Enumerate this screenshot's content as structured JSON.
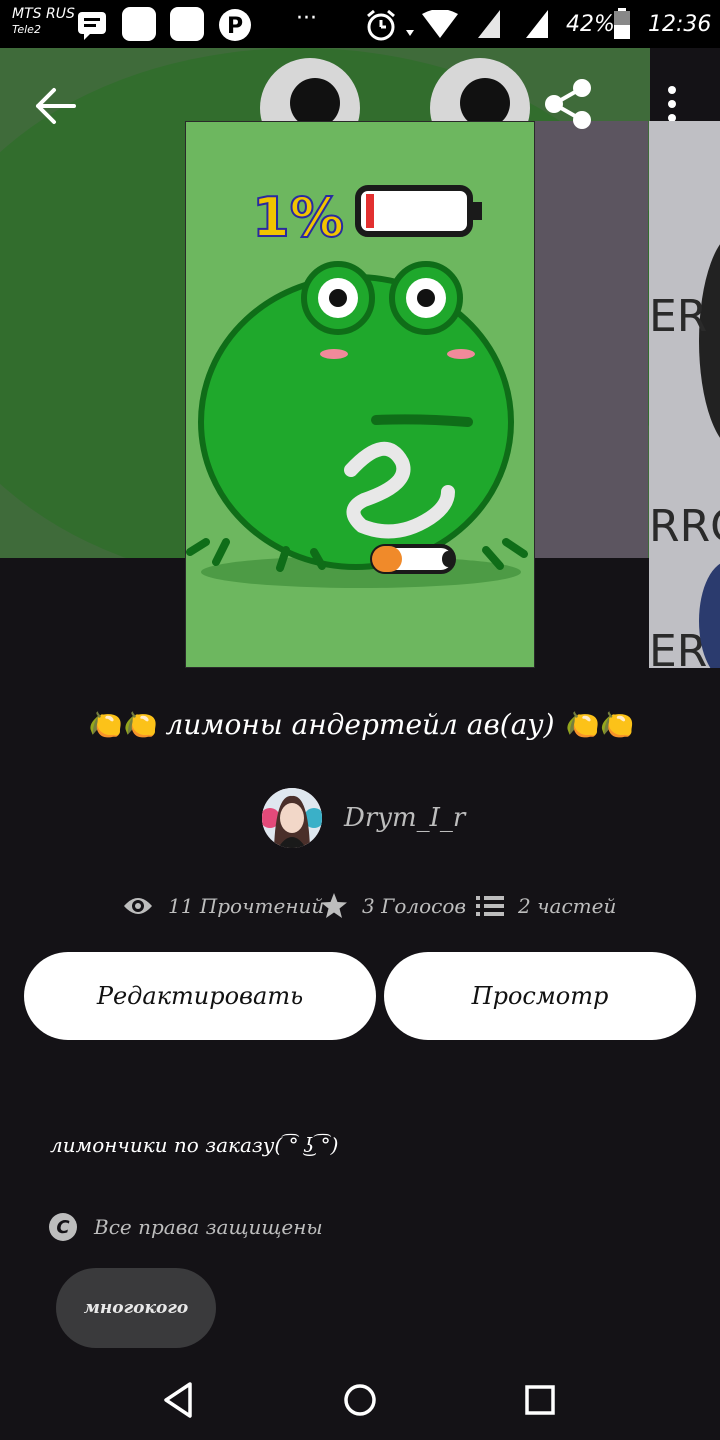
{
  "status_bar": {
    "carrier_primary": "MTS RUS",
    "carrier_secondary": "Tele2",
    "dots": "···",
    "battery": "42%",
    "time": "12:36"
  },
  "cover": {
    "battery_text": "1%"
  },
  "story": {
    "title": "🍋🍋 лимоны андертейл ав(ау) 🍋🍋",
    "author": "Drym_I_r",
    "reads": "11 Прочтений",
    "votes": "3 Голосов",
    "parts": "2 частей"
  },
  "actions": {
    "edit": "Редактировать",
    "preview": "Просмотр"
  },
  "description": "лимончики по заказу( ͡° ͜ʖ ͡°)",
  "rights": "Все права защищены",
  "tags": [
    "многокого"
  ],
  "colors": {
    "background": "#141216",
    "cover_green": "#6db75f",
    "frog_green": "#1fa82c"
  }
}
